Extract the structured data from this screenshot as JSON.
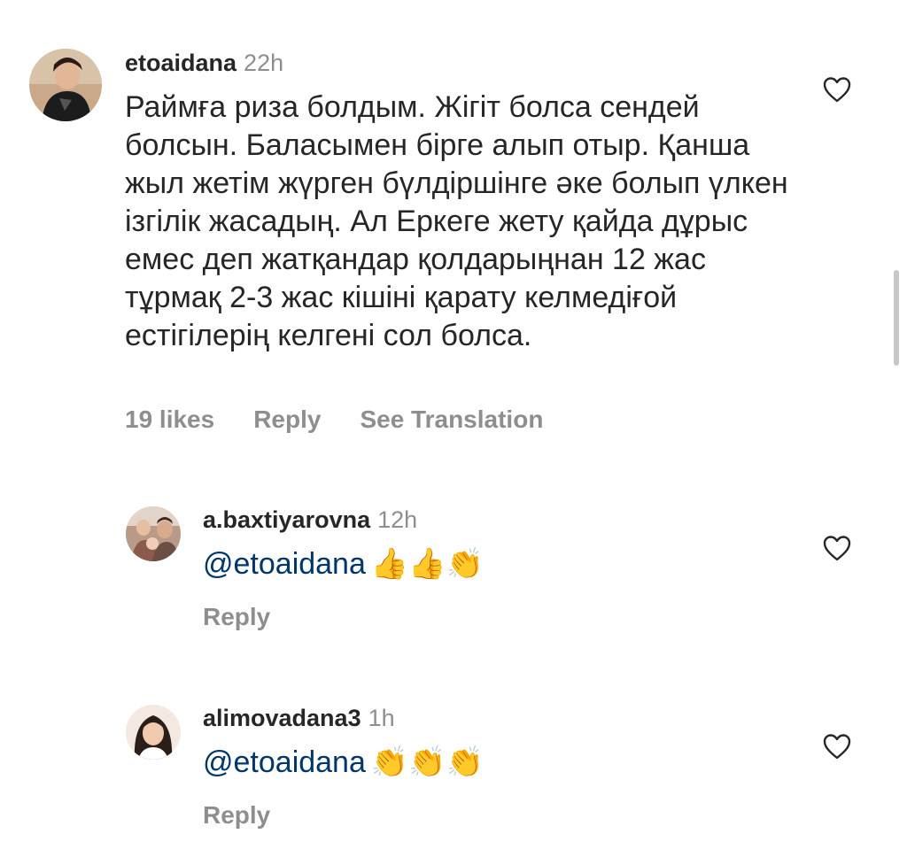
{
  "comments": [
    {
      "username": "etoaidana",
      "time": "22h",
      "text": "Раймға риза болдым. Жігіт болса сендей болсын. Баласымен бірге алып отыр. Қанша жыл жетім жүрген бүлдіршінге әке болып үлкен ізгілік жасадың.  Ал Еркеге жету қайда дұрыс емес деп жатқандар қолдарыңнан 12 жас тұрмақ 2-3 жас кішіні қарату келмедіғой естігілерің келгені сол болса.",
      "likes": "19 likes",
      "reply_label": "Reply",
      "translate_label": "See Translation"
    }
  ],
  "replies": [
    {
      "username": "a.baxtiyarovna",
      "time": "12h",
      "mention": "@etoaidana",
      "emojis": "👍👍👏",
      "reply_label": "Reply"
    },
    {
      "username": "alimovadana3",
      "time": "1h",
      "mention": "@etoaidana",
      "emojis": "👏👏👏",
      "reply_label": "Reply"
    }
  ],
  "icons": {
    "like": "heart-outline-icon"
  },
  "colors": {
    "text": "#262626",
    "secondary": "#8e8e8e",
    "mention": "#00376b"
  }
}
